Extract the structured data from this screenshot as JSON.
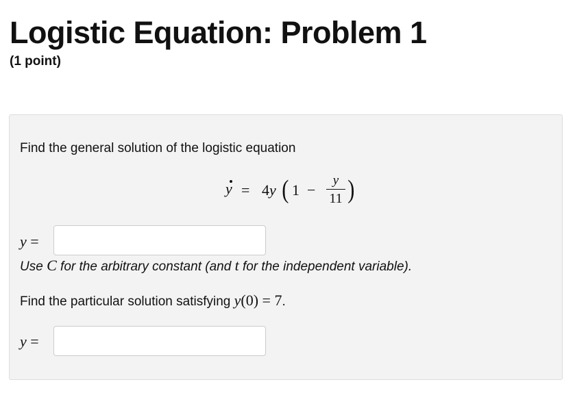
{
  "header": {
    "title": "Logistic Equation: Problem 1",
    "points": "(1 point)"
  },
  "problem": {
    "intro_text": "Find the general solution of the logistic equation",
    "equation": {
      "lhs": "y",
      "equals": "=",
      "coefficient": "4y",
      "one": "1",
      "minus": "−",
      "numerator": "y",
      "denominator": "11"
    },
    "answer1": {
      "label_var": "y",
      "label_eq": "=",
      "value": "",
      "placeholder": ""
    },
    "instruction": {
      "prefix": "Use ",
      "constant": "C",
      "middle": " for the arbitrary constant (and ",
      "independent_var": "t",
      "suffix": " for the independent variable)."
    },
    "particular": {
      "text": "Find the particular solution satisfying ",
      "cond_func": "y",
      "cond_arg": "(0)",
      "cond_eq": " = ",
      "cond_val": "7",
      "end": "."
    },
    "answer2": {
      "label_var": "y",
      "label_eq": "=",
      "value": "",
      "placeholder": ""
    }
  }
}
